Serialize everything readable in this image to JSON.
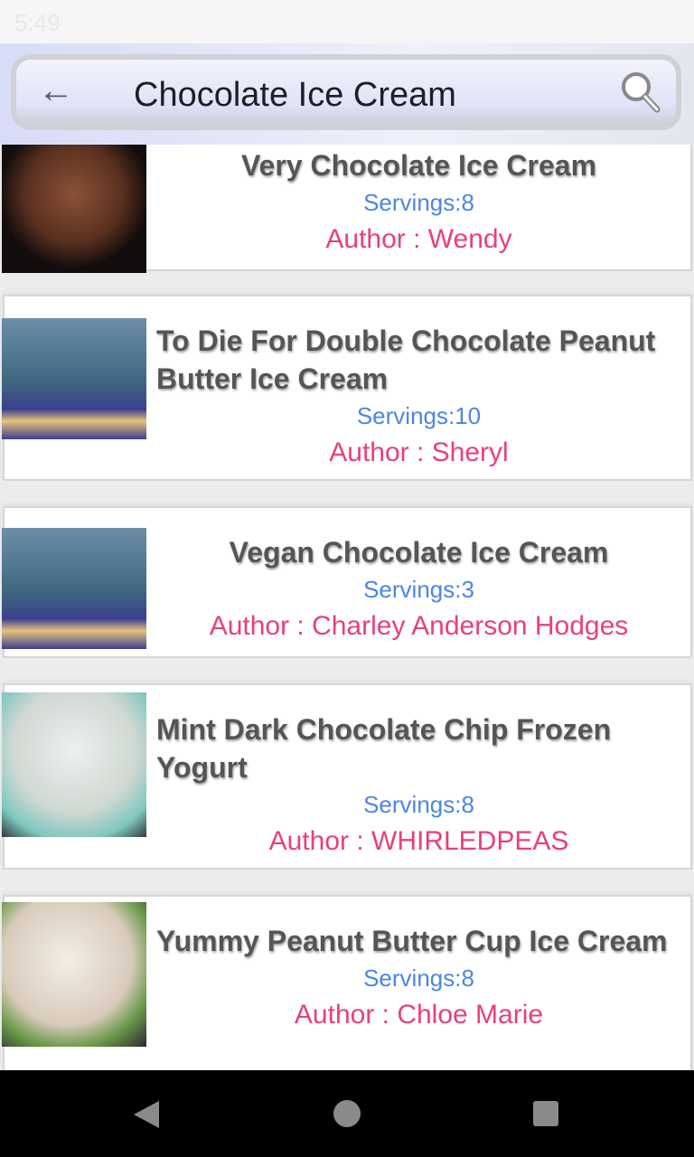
{
  "status_bar": {
    "time": "5:49"
  },
  "header": {
    "title": "Chocolate Ice Cream",
    "back_icon": "arrow-left-icon",
    "search_icon": "magnifier-icon"
  },
  "recipes": [
    {
      "title": "Very Chocolate Ice Cream",
      "servings": "Servings:8",
      "author": "Author : Wendy"
    },
    {
      "title": "To Die For Double Chocolate Peanut Butter Ice Cream",
      "servings": "Servings:10",
      "author": "Author : Sheryl"
    },
    {
      "title": "Vegan Chocolate Ice Cream",
      "servings": "Servings:3",
      "author": "Author : Charley Anderson Hodges"
    },
    {
      "title": "Mint Dark Chocolate Chip Frozen Yogurt",
      "servings": "Servings:8",
      "author": "Author : WHIRLEDPEAS"
    },
    {
      "title": "Yummy Peanut Butter Cup Ice Cream",
      "servings": "Servings:8",
      "author": "Author : Chloe Marie"
    }
  ]
}
